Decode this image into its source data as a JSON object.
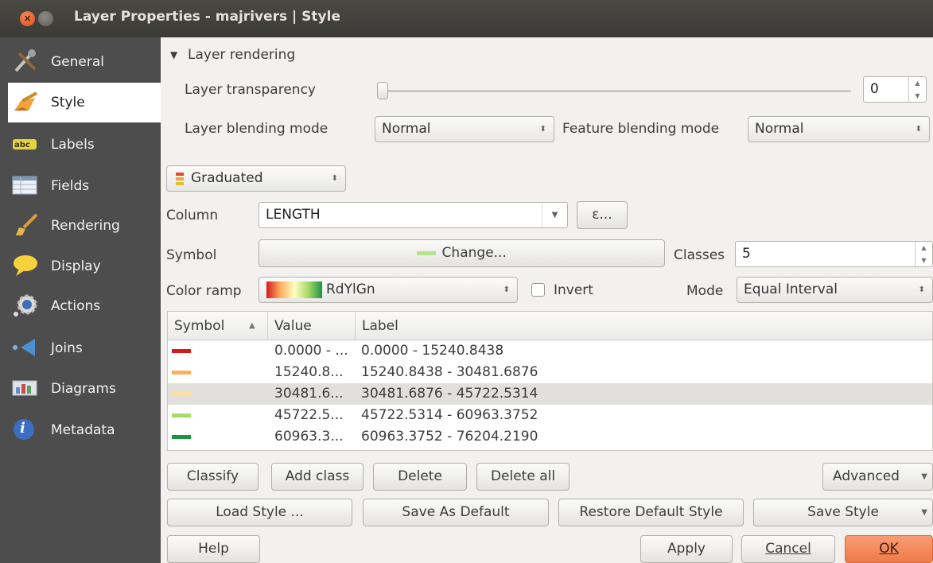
{
  "window": {
    "title": "Layer Properties - majrivers | Style"
  },
  "sidebar": {
    "items": [
      {
        "label": "General",
        "icon": "tools-icon"
      },
      {
        "label": "Style",
        "icon": "paintbrush-icon",
        "active": true
      },
      {
        "label": "Labels",
        "icon": "labels-abc-icon",
        "badge": "abc"
      },
      {
        "label": "Fields",
        "icon": "table-icon"
      },
      {
        "label": "Rendering",
        "icon": "brush-icon"
      },
      {
        "label": "Display",
        "icon": "speech-bubble-icon"
      },
      {
        "label": "Actions",
        "icon": "gear-icon"
      },
      {
        "label": "Joins",
        "icon": "join-arrow-icon"
      },
      {
        "label": "Diagrams",
        "icon": "diagram-icon"
      },
      {
        "label": "Metadata",
        "icon": "info-icon",
        "badge": "i"
      }
    ]
  },
  "layer_rendering": {
    "header": "Layer rendering",
    "transparency_label": "Layer transparency",
    "transparency_value": "0",
    "blending_label": "Layer blending mode",
    "blending_value": "Normal",
    "feature_blending_label": "Feature blending mode",
    "feature_blending_value": "Normal"
  },
  "renderer": {
    "type": "Graduated"
  },
  "column": {
    "label": "Column",
    "value": "LENGTH",
    "expr_button": "ε..."
  },
  "symbol": {
    "label": "Symbol",
    "change_button": "Change...",
    "swatch_color": "#b5e58a"
  },
  "classes": {
    "label": "Classes",
    "value": "5"
  },
  "color_ramp": {
    "label": "Color ramp",
    "value": "RdYlGn",
    "invert_label": "Invert",
    "invert_checked": false
  },
  "mode": {
    "label": "Mode",
    "value": "Equal Interval"
  },
  "table": {
    "headers": [
      "Symbol",
      "Value",
      "Label"
    ],
    "sort_indicator": "▲",
    "rows": [
      {
        "color": "#d7191c",
        "value": "0.0000 - ...",
        "label": "0.0000 - 15240.8438"
      },
      {
        "color": "#fdae61",
        "value": "15240.8...",
        "label": "15240.8438 - 30481.6876"
      },
      {
        "color": "#fedf9f",
        "value": "30481.6...",
        "label": "30481.6876 - 45722.5314",
        "selected": true
      },
      {
        "color": "#a6d96a",
        "value": "45722.5...",
        "label": "45722.5314 - 60963.3752"
      },
      {
        "color": "#1a9641",
        "value": "60963.3...",
        "label": "60963.3752 - 76204.2190"
      }
    ]
  },
  "actions": {
    "classify": "Classify",
    "add_class": "Add class",
    "delete": "Delete",
    "delete_all": "Delete all",
    "advanced": "Advanced"
  },
  "style_buttons": {
    "load": "Load Style ...",
    "save_default": "Save As Default",
    "restore_default": "Restore Default Style",
    "save": "Save Style"
  },
  "dialog_buttons": {
    "help": "Help",
    "apply": "Apply",
    "cancel": "Cancel",
    "ok": "OK"
  },
  "colors": {
    "ok_button": "#f4855a",
    "active_item_bg": "#ffffff",
    "sidebar_bg": "#4d4d4d"
  }
}
